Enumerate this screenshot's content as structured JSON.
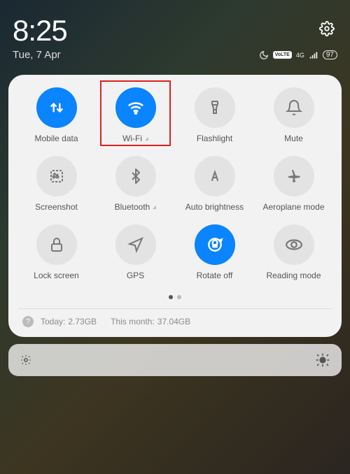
{
  "status": {
    "time": "8:25",
    "date": "Tue, 7 Apr",
    "network_label": "4G",
    "lte_badge": "VoLTE",
    "battery": "97"
  },
  "tiles": [
    {
      "id": "mobile-data",
      "label": "Mobile data",
      "active": true,
      "expandable": false,
      "highlight": false
    },
    {
      "id": "wifi",
      "label": "Wi-Fi",
      "active": true,
      "expandable": true,
      "highlight": true
    },
    {
      "id": "flashlight",
      "label": "Flashlight",
      "active": false,
      "expandable": false,
      "highlight": false
    },
    {
      "id": "mute",
      "label": "Mute",
      "active": false,
      "expandable": false,
      "highlight": false
    },
    {
      "id": "screenshot",
      "label": "Screenshot",
      "active": false,
      "expandable": false,
      "highlight": false
    },
    {
      "id": "bluetooth",
      "label": "Bluetooth",
      "active": false,
      "expandable": true,
      "highlight": false
    },
    {
      "id": "auto-bright",
      "label": "Auto brightness",
      "active": false,
      "expandable": false,
      "highlight": false
    },
    {
      "id": "aeroplane",
      "label": "Aeroplane mode",
      "active": false,
      "expandable": false,
      "highlight": false
    },
    {
      "id": "lock",
      "label": "Lock screen",
      "active": false,
      "expandable": false,
      "highlight": false
    },
    {
      "id": "gps",
      "label": "GPS",
      "active": false,
      "expandable": false,
      "highlight": false
    },
    {
      "id": "rotate",
      "label": "Rotate off",
      "active": true,
      "expandable": false,
      "highlight": false
    },
    {
      "id": "reading",
      "label": "Reading mode",
      "active": false,
      "expandable": false,
      "highlight": false
    }
  ],
  "usage": {
    "today_label": "Today:",
    "today_value": "2.73GB",
    "month_label": "This month:",
    "month_value": "37.04GB"
  }
}
